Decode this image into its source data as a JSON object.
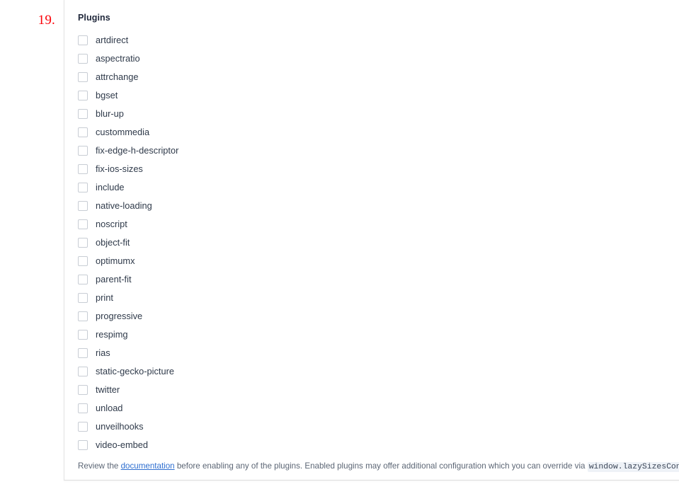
{
  "annotation": {
    "marker_label": "19.",
    "marker_color": "#fb0007"
  },
  "panel": {
    "section_title": "Plugins",
    "plugins": [
      {
        "name": "artdirect",
        "checked": false
      },
      {
        "name": "aspectratio",
        "checked": false
      },
      {
        "name": "attrchange",
        "checked": false
      },
      {
        "name": "bgset",
        "checked": false
      },
      {
        "name": "blur-up",
        "checked": false
      },
      {
        "name": "custommedia",
        "checked": false
      },
      {
        "name": "fix-edge-h-descriptor",
        "checked": false
      },
      {
        "name": "fix-ios-sizes",
        "checked": false
      },
      {
        "name": "include",
        "checked": false
      },
      {
        "name": "native-loading",
        "checked": false
      },
      {
        "name": "noscript",
        "checked": false
      },
      {
        "name": "object-fit",
        "checked": false
      },
      {
        "name": "optimumx",
        "checked": false
      },
      {
        "name": "parent-fit",
        "checked": false
      },
      {
        "name": "print",
        "checked": false
      },
      {
        "name": "progressive",
        "checked": false
      },
      {
        "name": "respimg",
        "checked": false
      },
      {
        "name": "rias",
        "checked": false
      },
      {
        "name": "static-gecko-picture",
        "checked": false
      },
      {
        "name": "twitter",
        "checked": false
      },
      {
        "name": "unload",
        "checked": false
      },
      {
        "name": "unveilhooks",
        "checked": false
      },
      {
        "name": "video-embed",
        "checked": false
      }
    ],
    "footer": {
      "text_before_link": "Review the ",
      "link_label": "documentation",
      "text_after_link": " before enabling any of the plugins. Enabled plugins may offer additional configuration which you can override via ",
      "code_snippet": "window.lazySizesConfig"
    }
  },
  "colors": {
    "link": "#2f6fd0",
    "text": "#2f3a4a",
    "muted_text": "#5c6675",
    "checkbox_border": "#c8cdd4",
    "panel_background": "#ffffff",
    "code_background": "#eef2f7"
  }
}
